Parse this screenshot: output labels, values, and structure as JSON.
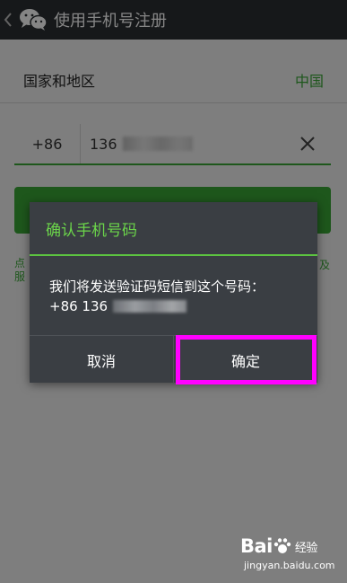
{
  "header": {
    "back_icon": "chevron-left-icon",
    "app_icon": "wechat-logo-icon",
    "title": "使用手机号注册"
  },
  "form": {
    "country_label": "国家和地区",
    "country_value": "中国",
    "country_code": "+86",
    "phone_prefix": "136",
    "clear_icon": "close-icon",
    "agree_left": [
      "点",
      "服"
    ],
    "agree_right": [
      "及",
      ""
    ]
  },
  "dialog": {
    "title": "确认手机号码",
    "message": "我们将发送验证码短信到这个号码：",
    "number_prefix": "+86 136",
    "cancel_label": "取消",
    "confirm_label": "确定"
  },
  "watermark": {
    "logo_text": "Bai",
    "logo_text2": "经验",
    "url": "jingyan.baidu.com"
  },
  "colors": {
    "accent_green": "#3aa836",
    "dialog_title_green": "#6bd44a",
    "highlight": "#ff00ff",
    "titlebar": "#2b2f33",
    "dialog_bg": "#3a3e43"
  }
}
